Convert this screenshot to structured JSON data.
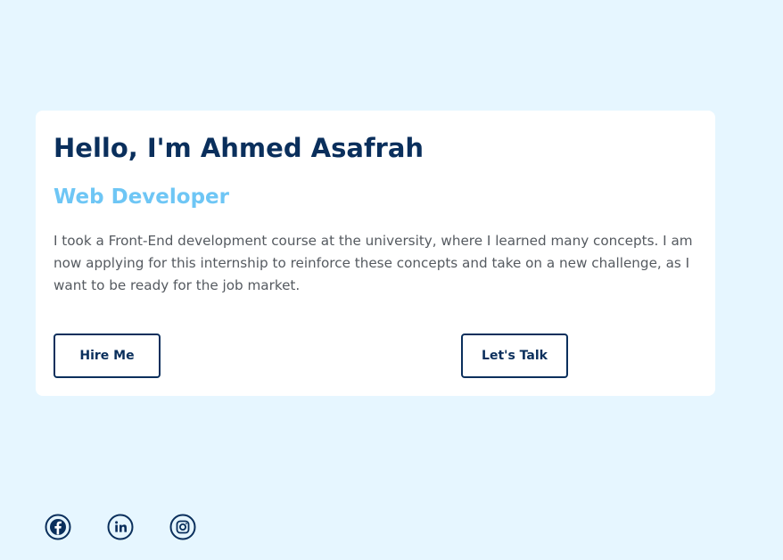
{
  "hero": {
    "heading": "Hello, I'm Ahmed Asafrah",
    "role": "Web Developer",
    "bio": "I took a Front-End development course at the university, where I learned many concepts. I am now applying for this internship to reinforce these concepts and take on a new challenge, as I want to be ready for the job market.",
    "buttons": {
      "hire_label": "Hire Me",
      "talk_label": "Let's Talk"
    }
  },
  "social": {
    "icons": [
      "facebook-icon",
      "linkedin-icon",
      "instagram-icon"
    ]
  },
  "colors": {
    "background": "#e6f6ff",
    "card": "#ffffff",
    "primary": "#0a2f5c",
    "accent": "#6ec6f5",
    "body_text": "#555a60"
  }
}
